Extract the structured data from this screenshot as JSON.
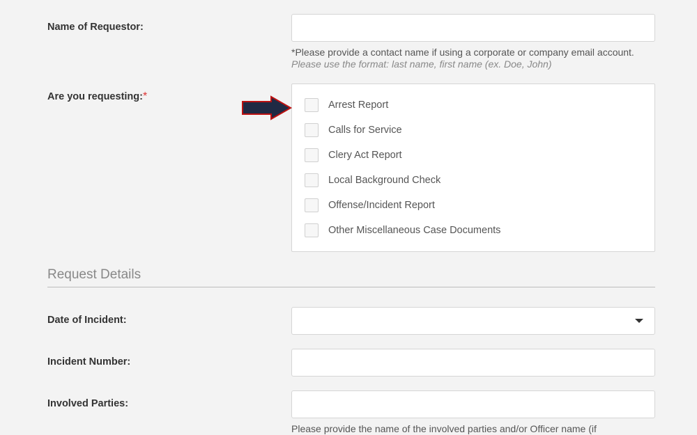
{
  "fields": {
    "nameOfRequestor": {
      "label": "Name of Requestor:",
      "required": false,
      "help1": "*Please provide a contact name if using a corporate or company email account.",
      "help2": "Please use the format: last name, first name (ex. Doe, John)"
    },
    "areYouRequesting": {
      "label": "Are you requesting:",
      "required": true,
      "options": [
        "Arrest Report",
        "Calls for Service",
        "Clery Act Report",
        "Local Background Check",
        "Offense/Incident Report",
        "Other Miscellaneous Case Documents"
      ]
    },
    "dateOfIncident": {
      "label": "Date of Incident:",
      "required": false
    },
    "incidentNumber": {
      "label": "Incident Number:",
      "required": false
    },
    "involvedParties": {
      "label": "Involved Parties:",
      "required": false,
      "help1": "Please provide the name of the involved parties and/or Officer name (if"
    }
  },
  "section": {
    "requestDetails": "Request Details"
  },
  "requiredMark": "*"
}
